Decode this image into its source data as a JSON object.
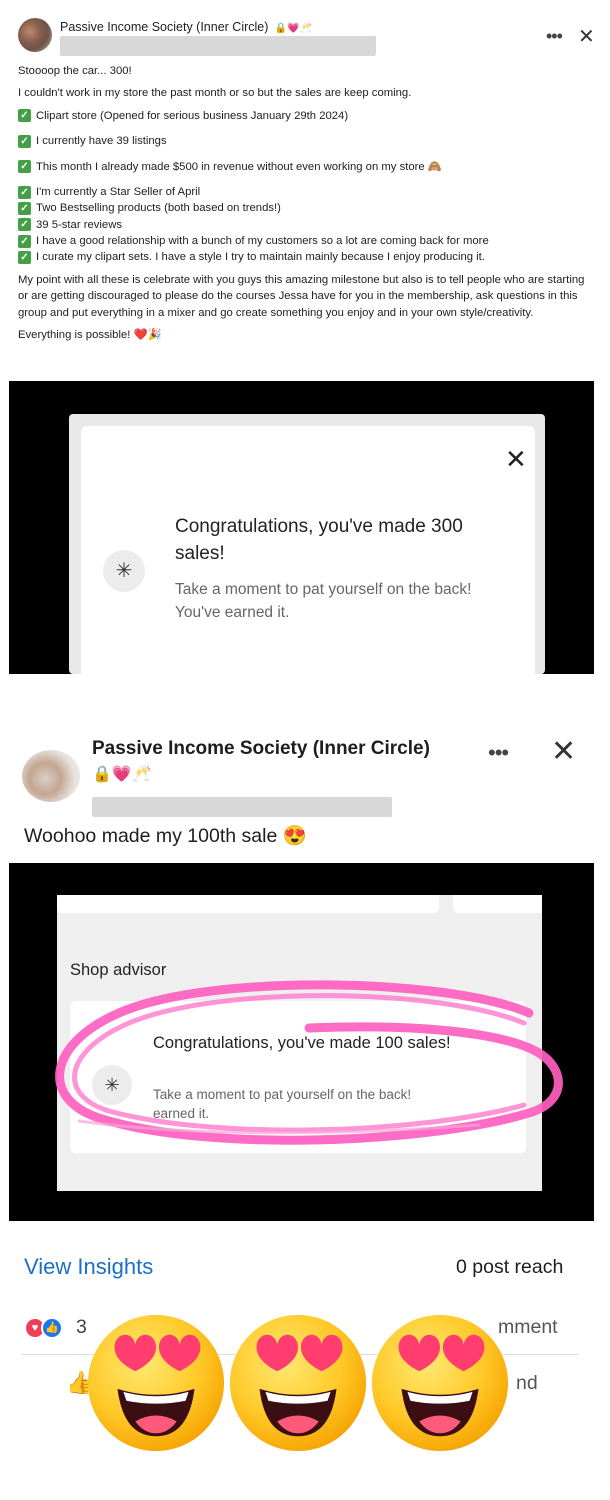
{
  "post1": {
    "group_name": "Passive Income Society (Inner Circle)",
    "group_emojis": "🔒💗🥂",
    "body": {
      "intro1": "Stoooop the car... 300!",
      "intro2": "I couldn't work in my store the past month or so but the sales are keep coming.",
      "checks": [
        "Clipart store (Opened for serious business January 29th 2024)",
        "I currently have 39 listings",
        "This month I already made $500 in revenue without even working on my store 🙈",
        "I'm currently a Star Seller of April",
        "Two Bestselling products (both based on trends!)",
        "39 5-star reviews",
        "I have a good relationship with a bunch of my customers so a lot are coming back for more",
        "I curate my clipart sets. I have a style I try to maintain mainly because I enjoy producing it."
      ],
      "closing": "My point with all these is celebrate with you guys this amazing milestone but also is to tell people who are starting or are getting discouraged to please do the courses Jessa have for you in the membership, ask questions in this group and put everything in a mixer and go create something you enjoy and in your own style/creativity.",
      "final": "Everything is possible! ❤️🎉"
    },
    "screenshot": {
      "title": "Congratulations, you've made 300 sales!",
      "subtitle": "Take a moment to pat yourself on the back! You've earned it."
    }
  },
  "post2": {
    "group_name": "Passive Income Society (Inner Circle)",
    "group_emojis": "🔒💗🥂",
    "text": "Woohoo made my 100th sale 😍",
    "screenshot": {
      "section_label": "Shop advisor",
      "title": "Congratulations, you've made 100 sales!",
      "subtitle_line1": "Take a moment to pat yourself on the back!",
      "subtitle_line2": "earned it."
    }
  },
  "footer": {
    "insights_label": "View Insights",
    "reach_text": "0 post reach",
    "reaction_count": "3",
    "comment_fragment": "mment",
    "send_fragment": "nd"
  },
  "icons": {
    "more": "more-dots-icon",
    "close": "close-icon",
    "check": "green-checkbox-icon",
    "sparkle": "sparkle-icon",
    "heart_reaction": "heart-reaction-icon",
    "like_reaction": "like-reaction-icon",
    "like_button": "thumbs-up-icon",
    "sticker": "heart-eyes-emoji"
  },
  "colors": {
    "link_blue": "#1a6fc9",
    "check_green": "#43a047",
    "highlight_pink": "#ff5fc0",
    "reaction_red": "#f33e58",
    "reaction_blue": "#1877f2"
  }
}
